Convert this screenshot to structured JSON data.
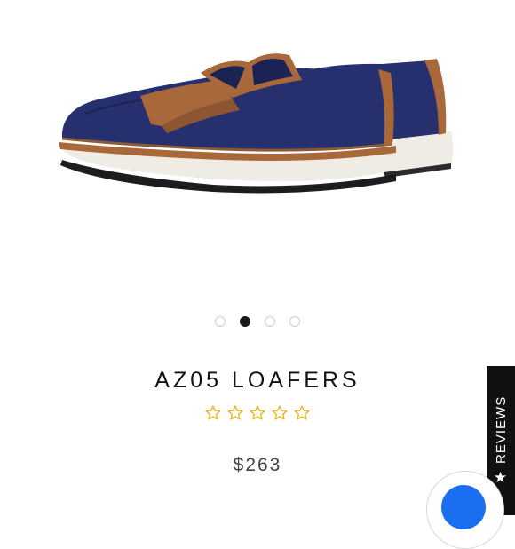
{
  "product": {
    "title": "AZ05 LOAFERS",
    "price": "$263",
    "rating": 0,
    "max_rating": 5
  },
  "carousel": {
    "count": 4,
    "active_index": 1
  },
  "reviews_tab": {
    "label": "REVIEWS",
    "icon": "star-icon"
  },
  "chat_widget": {
    "icon": "chat-bubble-icon",
    "color": "#1a6ff0"
  },
  "colors": {
    "star_outline": "#e8b41f",
    "suede": "#26306e",
    "leather": "#a8683a",
    "sole": "#efece6"
  }
}
